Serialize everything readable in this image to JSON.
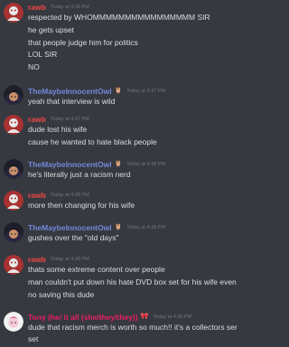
{
  "messages": [
    {
      "user": "rawb",
      "color": "#f04747",
      "timestamp": "Today at 4:36 PM",
      "avatar": "rawb-avatar",
      "lines": [
        "respected by WHOMMMMMMMMMMMMMMMM SIR",
        "he gets upset",
        "that people judge him for politics",
        "LOL SIR",
        "NO"
      ]
    },
    {
      "user": "TheMaybeInnocentOwl",
      "color": "#7289da",
      "badge": "🦉",
      "timestamp": "Today at 4:37 PM",
      "avatar": "owl-avatar",
      "lines": [
        "yeah that interview is wild"
      ]
    },
    {
      "user": "rawb",
      "color": "#f04747",
      "timestamp": "Today at 4:37 PM",
      "avatar": "rawb-avatar",
      "lines": [
        "dude lost his wife",
        "cause he wanted to hate black people"
      ]
    },
    {
      "user": "TheMaybeInnocentOwl",
      "color": "#7289da",
      "badge": "🦉",
      "timestamp": "Today at 4:38 PM",
      "avatar": "owl-avatar",
      "lines": [
        "he's literally just a racism nerd"
      ]
    },
    {
      "user": "rawb",
      "color": "#f04747",
      "timestamp": "Today at 4:38 PM",
      "avatar": "rawb-avatar",
      "lines": [
        "more then changing for his wife"
      ]
    },
    {
      "user": "TheMaybeInnocentOwl",
      "color": "#7289da",
      "badge": "🦉",
      "timestamp": "Today at 4:38 PM",
      "avatar": "owl-avatar",
      "lines": [
        "gushes over the \"old days\""
      ]
    },
    {
      "user": "rawb",
      "color": "#f04747",
      "timestamp": "Today at 4:38 PM",
      "avatar": "rawb-avatar",
      "lines": [
        "thats some extreme content over people",
        "man couldn't put down his hate DVD box set for his wife even",
        "no saving this dude"
      ]
    },
    {
      "user": "Tony (he/ it all (she/they/they))",
      "color": "#e91e63",
      "badge": "🎀",
      "timestamp": "Today at 4:39 PM",
      "avatar": "tony-avatar",
      "lines": [
        "dude that racism merch is worth so much!! it's a collectors ser",
        "set"
      ]
    }
  ]
}
